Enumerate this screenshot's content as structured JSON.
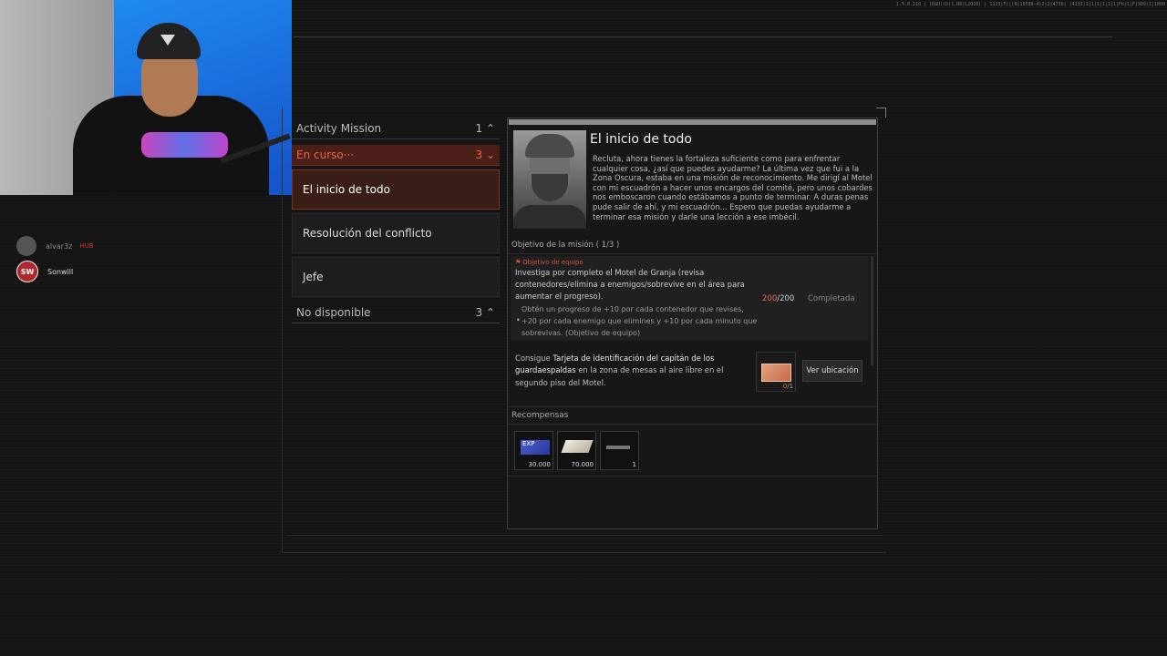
{
  "version_text": "1.5.0.116 | (R&D)(D)1.R6(L2020) | 1123|F|||9|19598-4|2|2|4730| |4133|1|1|1|1|1|1|Fb|1|F|909|1|1000",
  "chat": [
    {
      "avatar": "",
      "name": "alvar3z",
      "badge": "HUB"
    },
    {
      "avatar": "SW",
      "name": "Sonwill"
    }
  ],
  "missions": {
    "activity": {
      "label": "Activity Mission",
      "count": "1"
    },
    "in_progress": {
      "label": "En curso···",
      "count": "3"
    },
    "items": [
      {
        "label": "El inicio de todo"
      },
      {
        "label": "Resolución del conflicto"
      },
      {
        "label": "Jefe"
      }
    ],
    "unavailable": {
      "label": "No disponible",
      "count": "3"
    }
  },
  "detail": {
    "title": "El inicio de todo",
    "description": "Recluta, ahora tienes la fortaleza suficiente como para enfrentar cualquier cosa, ¿así que puedes ayudarme? La última vez que fui a la Zona Oscura, estaba en una misión de reconocimiento. Me dirigí al Motel con mi escuadrón a hacer unos encargos del comité, pero unos cobardes nos emboscaron cuando estábamos a punto de terminar. A duras penas pude salir de ahí, y mi escuadrón... Espero que puedas ayudarme a terminar esa misión y darle una lección a ese imbécil.",
    "objectives_header": "Objetivo de la misión ( 1/3 )",
    "objective1": {
      "tag": "Objetivo de equipo",
      "text": "Investiga por completo el Motel de Granja (revisa contenedores/elimina a enemigos/sobrevive en el área para aumentar el progreso).",
      "sub": "Obtén un progreso de +10 por cada contenedor que revises, +20 por cada enemigo que elimines y +10 por cada minuto que sobrevivas. (Objetivo de equipo)",
      "bullet": "•",
      "progress_current": "200",
      "progress_total": "/200",
      "status": "Completada"
    },
    "objective2": {
      "prefix": "Consigue ",
      "highlight": "Tarjeta de identificación del capitán de los guardaespaldas",
      "suffix": " en la zona de mesas al aire libre en el segundo piso del Motel.",
      "item_have": "0",
      "item_need": "/1",
      "location_button": "Ver ubicación"
    },
    "rewards_header": "Recompensas",
    "rewards": [
      {
        "icon": "xp-card-icon",
        "label": "EXP",
        "qty": "30.000"
      },
      {
        "icon": "cash-icon",
        "qty": "70.000"
      },
      {
        "icon": "rifle-icon",
        "qty": "1"
      }
    ]
  }
}
